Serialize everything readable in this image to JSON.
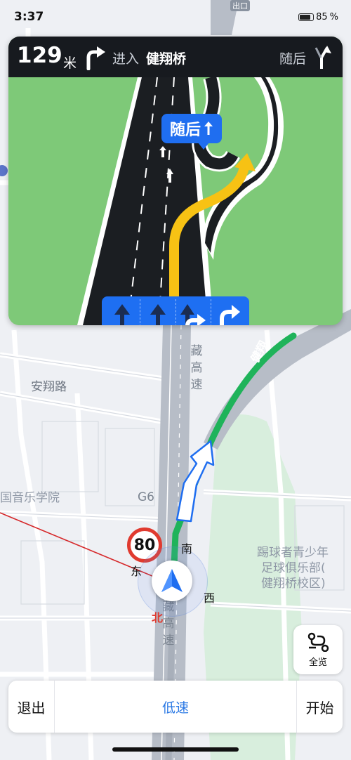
{
  "status_bar": {
    "time": "3:37",
    "battery": "85"
  },
  "guidance": {
    "distance": "129",
    "distance_unit": "米",
    "action": "进入",
    "road": "健翔桥",
    "next_label": "随后",
    "turn_icon": "turn-right-icon",
    "next_icon": "slight-left-icon",
    "callout_text": "随后",
    "callout_icon": "arrow-up-icon",
    "lanes": [
      {
        "icon": "straight-arrow-icon",
        "recommended": false
      },
      {
        "icon": "straight-arrow-icon",
        "recommended": false
      },
      {
        "icon": "straight-right-arrow-icon",
        "recommended": true
      },
      {
        "icon": "right-turn-arrow-icon",
        "recommended": true
      }
    ]
  },
  "map": {
    "labels": {
      "anxiang_road": "安翔路",
      "music_college": "国音乐学院",
      "football_club": [
        "踢球者青少年",
        "足球俱乐部(",
        "健翔桥校区)"
      ],
      "zang_highway_top": "藏高速",
      "zang_highway_bottom": "藏高速",
      "jianxiang_bridge": "健翔",
      "g6": "G6",
      "exit": "出口"
    },
    "speed_limit": "80",
    "compass": {
      "north": "北",
      "south": "南",
      "east": "东",
      "west": "西"
    }
  },
  "controls": {
    "overview_label": "全览",
    "overview_icon": "route-overview-icon"
  },
  "bottom_bar": {
    "exit_label": "退出",
    "mode_label": "低速",
    "start_label": "开始"
  },
  "colors": {
    "accent": "#1f6ef0",
    "route_green": "#1fb35a",
    "lane_yellow": "#f7c214",
    "speed_red": "#e03a2f"
  }
}
